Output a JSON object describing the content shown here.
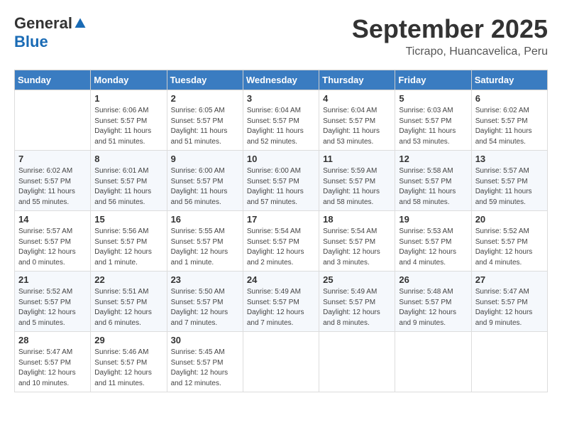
{
  "logo": {
    "general": "General",
    "blue": "Blue"
  },
  "title": "September 2025",
  "location": "Ticrapo, Huancavelica, Peru",
  "days_of_week": [
    "Sunday",
    "Monday",
    "Tuesday",
    "Wednesday",
    "Thursday",
    "Friday",
    "Saturday"
  ],
  "weeks": [
    [
      {
        "day": "",
        "info": ""
      },
      {
        "day": "1",
        "info": "Sunrise: 6:06 AM\nSunset: 5:57 PM\nDaylight: 11 hours\nand 51 minutes."
      },
      {
        "day": "2",
        "info": "Sunrise: 6:05 AM\nSunset: 5:57 PM\nDaylight: 11 hours\nand 51 minutes."
      },
      {
        "day": "3",
        "info": "Sunrise: 6:04 AM\nSunset: 5:57 PM\nDaylight: 11 hours\nand 52 minutes."
      },
      {
        "day": "4",
        "info": "Sunrise: 6:04 AM\nSunset: 5:57 PM\nDaylight: 11 hours\nand 53 minutes."
      },
      {
        "day": "5",
        "info": "Sunrise: 6:03 AM\nSunset: 5:57 PM\nDaylight: 11 hours\nand 53 minutes."
      },
      {
        "day": "6",
        "info": "Sunrise: 6:02 AM\nSunset: 5:57 PM\nDaylight: 11 hours\nand 54 minutes."
      }
    ],
    [
      {
        "day": "7",
        "info": "Sunrise: 6:02 AM\nSunset: 5:57 PM\nDaylight: 11 hours\nand 55 minutes."
      },
      {
        "day": "8",
        "info": "Sunrise: 6:01 AM\nSunset: 5:57 PM\nDaylight: 11 hours\nand 56 minutes."
      },
      {
        "day": "9",
        "info": "Sunrise: 6:00 AM\nSunset: 5:57 PM\nDaylight: 11 hours\nand 56 minutes."
      },
      {
        "day": "10",
        "info": "Sunrise: 6:00 AM\nSunset: 5:57 PM\nDaylight: 11 hours\nand 57 minutes."
      },
      {
        "day": "11",
        "info": "Sunrise: 5:59 AM\nSunset: 5:57 PM\nDaylight: 11 hours\nand 58 minutes."
      },
      {
        "day": "12",
        "info": "Sunrise: 5:58 AM\nSunset: 5:57 PM\nDaylight: 11 hours\nand 58 minutes."
      },
      {
        "day": "13",
        "info": "Sunrise: 5:57 AM\nSunset: 5:57 PM\nDaylight: 11 hours\nand 59 minutes."
      }
    ],
    [
      {
        "day": "14",
        "info": "Sunrise: 5:57 AM\nSunset: 5:57 PM\nDaylight: 12 hours\nand 0 minutes."
      },
      {
        "day": "15",
        "info": "Sunrise: 5:56 AM\nSunset: 5:57 PM\nDaylight: 12 hours\nand 1 minute."
      },
      {
        "day": "16",
        "info": "Sunrise: 5:55 AM\nSunset: 5:57 PM\nDaylight: 12 hours\nand 1 minute."
      },
      {
        "day": "17",
        "info": "Sunrise: 5:54 AM\nSunset: 5:57 PM\nDaylight: 12 hours\nand 2 minutes."
      },
      {
        "day": "18",
        "info": "Sunrise: 5:54 AM\nSunset: 5:57 PM\nDaylight: 12 hours\nand 3 minutes."
      },
      {
        "day": "19",
        "info": "Sunrise: 5:53 AM\nSunset: 5:57 PM\nDaylight: 12 hours\nand 4 minutes."
      },
      {
        "day": "20",
        "info": "Sunrise: 5:52 AM\nSunset: 5:57 PM\nDaylight: 12 hours\nand 4 minutes."
      }
    ],
    [
      {
        "day": "21",
        "info": "Sunrise: 5:52 AM\nSunset: 5:57 PM\nDaylight: 12 hours\nand 5 minutes."
      },
      {
        "day": "22",
        "info": "Sunrise: 5:51 AM\nSunset: 5:57 PM\nDaylight: 12 hours\nand 6 minutes."
      },
      {
        "day": "23",
        "info": "Sunrise: 5:50 AM\nSunset: 5:57 PM\nDaylight: 12 hours\nand 7 minutes."
      },
      {
        "day": "24",
        "info": "Sunrise: 5:49 AM\nSunset: 5:57 PM\nDaylight: 12 hours\nand 7 minutes."
      },
      {
        "day": "25",
        "info": "Sunrise: 5:49 AM\nSunset: 5:57 PM\nDaylight: 12 hours\nand 8 minutes."
      },
      {
        "day": "26",
        "info": "Sunrise: 5:48 AM\nSunset: 5:57 PM\nDaylight: 12 hours\nand 9 minutes."
      },
      {
        "day": "27",
        "info": "Sunrise: 5:47 AM\nSunset: 5:57 PM\nDaylight: 12 hours\nand 9 minutes."
      }
    ],
    [
      {
        "day": "28",
        "info": "Sunrise: 5:47 AM\nSunset: 5:57 PM\nDaylight: 12 hours\nand 10 minutes."
      },
      {
        "day": "29",
        "info": "Sunrise: 5:46 AM\nSunset: 5:57 PM\nDaylight: 12 hours\nand 11 minutes."
      },
      {
        "day": "30",
        "info": "Sunrise: 5:45 AM\nSunset: 5:57 PM\nDaylight: 12 hours\nand 12 minutes."
      },
      {
        "day": "",
        "info": ""
      },
      {
        "day": "",
        "info": ""
      },
      {
        "day": "",
        "info": ""
      },
      {
        "day": "",
        "info": ""
      }
    ]
  ]
}
